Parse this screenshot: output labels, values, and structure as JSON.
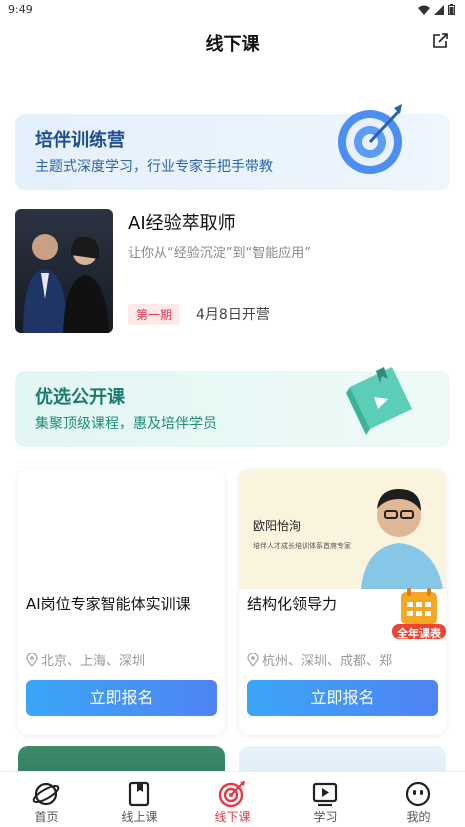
{
  "status_bar": {
    "time": "9:49"
  },
  "header": {
    "title": "线下课",
    "share_icon": "share-icon"
  },
  "camp_banner": {
    "title": "培伴训练营",
    "subtitle": "主题式深度学习，行业专家手把手带教"
  },
  "featured_course": {
    "title": "AI经验萃取师",
    "subtitle": "让你从“经验沉淀”到“智能应用”",
    "badge": "第一期",
    "open_date": "4月8日开营"
  },
  "public_banner": {
    "title": "优选公开课",
    "subtitle": "集聚顶级课程，惠及培伴学员"
  },
  "course_cards": [
    {
      "title": "AI岗位专家智能体实训课",
      "locations": "北京、上海、深圳",
      "button": "立即报名"
    },
    {
      "speaker_name": "欧阳怡洵",
      "speaker_desc": "培伴人才成长培训体系首席专家",
      "title": "结构化领导力",
      "locations": "杭州、深圳、成都、郑",
      "button": "立即报名"
    }
  ],
  "calendar_badge": {
    "label": "全年课表"
  },
  "tabbar": {
    "items": [
      {
        "label": "首页",
        "icon": "planet-icon"
      },
      {
        "label": "线上课",
        "icon": "book-icon"
      },
      {
        "label": "线下课",
        "icon": "target-icon",
        "active": true
      },
      {
        "label": "学习",
        "icon": "play-icon"
      },
      {
        "label": "我的",
        "icon": "face-icon"
      }
    ]
  },
  "colors": {
    "accent": "#e63946",
    "button": "#4a8df5",
    "camp_title": "#1f4f8f",
    "public_title": "#1b7a6e"
  }
}
